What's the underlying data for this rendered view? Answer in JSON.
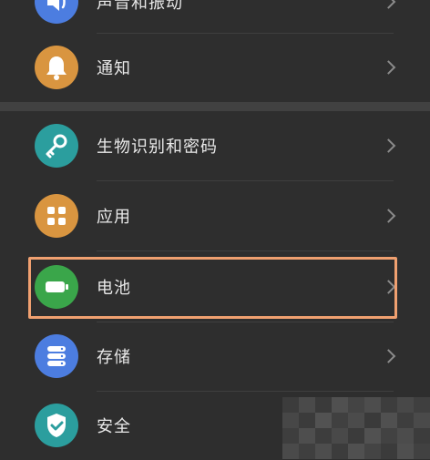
{
  "settings": {
    "items": [
      {
        "label": "声音和振动",
        "icon": "volume-icon",
        "color": "#4c7de0"
      },
      {
        "label": "通知",
        "icon": "bell-icon",
        "color": "#d99540"
      },
      {
        "label": "生物识别和密码",
        "icon": "key-icon",
        "color": "#2b9e9e"
      },
      {
        "label": "应用",
        "icon": "apps-grid-icon",
        "color": "#d99540"
      },
      {
        "label": "电池",
        "icon": "battery-icon",
        "color": "#3aa64a"
      },
      {
        "label": "存储",
        "icon": "storage-icon",
        "color": "#4c7de0"
      },
      {
        "label": "安全",
        "icon": "shield-check-icon",
        "color": "#2b9e9e"
      }
    ],
    "highlighted_item": "电池",
    "highlight_color": "#f0a070"
  }
}
